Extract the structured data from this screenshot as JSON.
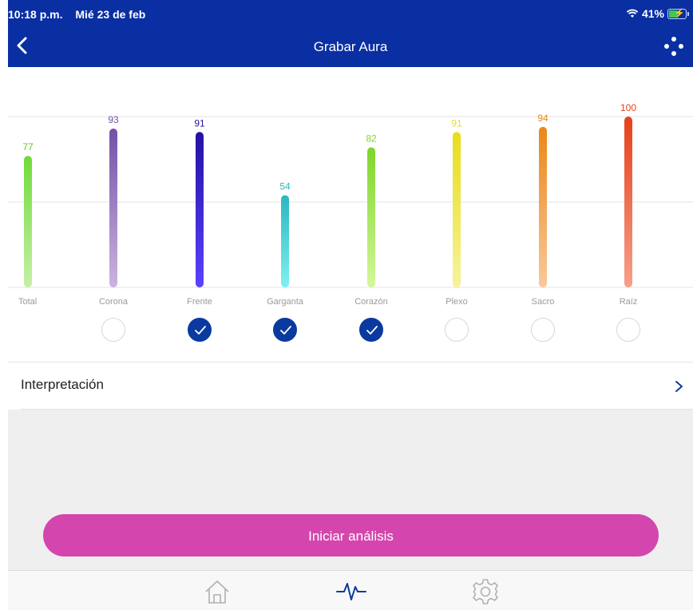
{
  "status_bar": {
    "time": "10:18 p.m.",
    "date": "Mié 23 de feb",
    "battery": "41%"
  },
  "header": {
    "title": "Grabar Aura"
  },
  "icons": {
    "back": "chevron-left-icon",
    "more": "dots-icon",
    "check": "checkmark-icon",
    "home": "home-icon",
    "pulse": "heartbeat-icon",
    "settings": "gear-icon"
  },
  "chart_data": {
    "type": "bar",
    "categories": [
      "Total",
      "Corona",
      "Frente",
      "Garganta",
      "Corazón",
      "Plexo",
      "Sacro",
      "Raíz"
    ],
    "values": [
      77,
      93,
      91,
      54,
      82,
      91,
      94,
      100
    ],
    "ylim": [
      0,
      100
    ],
    "grid": true,
    "colors": [
      [
        "#6fdb3a",
        "#c6f0a6"
      ],
      [
        "#7350a8",
        "#cbb4e0"
      ],
      [
        "#2511a3",
        "#5a42ff"
      ],
      [
        "#2bb6c2",
        "#7ff0f0"
      ],
      [
        "#7ed62a",
        "#d4f79b"
      ],
      [
        "#e8dd1a",
        "#f7f39a"
      ],
      [
        "#ea8818",
        "#f9c89a"
      ],
      [
        "#e6401a",
        "#f6a08a"
      ]
    ],
    "label_colors": [
      "#5acd28",
      "#7350a8",
      "#2511a3",
      "#2bb6c2",
      "#7ed62a",
      "#e8dd1a",
      "#ea8818",
      "#e6401a"
    ]
  },
  "selection": [
    false,
    false,
    true,
    true,
    true,
    false,
    false,
    false
  ],
  "interpretation": {
    "label": "Interpretación"
  },
  "actions": {
    "start_label": "Iniciar análisis"
  }
}
